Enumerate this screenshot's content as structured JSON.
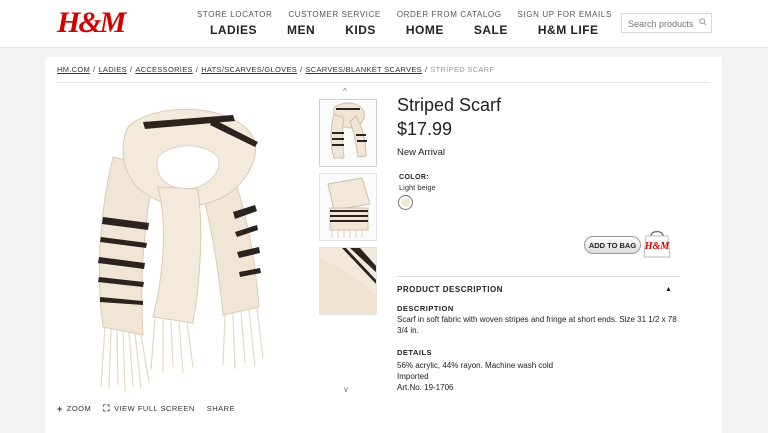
{
  "brand": {
    "logo": "H&M",
    "logo_color": "#d50000"
  },
  "header": {
    "utility_links": [
      "STORE LOCATOR",
      "CUSTOMER SERVICE",
      "ORDER FROM CATALOG",
      "SIGN UP FOR EMAILS"
    ],
    "nav": [
      "LADIES",
      "MEN",
      "KIDS",
      "HOME",
      "SALE",
      "H&M LIFE"
    ],
    "search_placeholder": "Search products"
  },
  "breadcrumb": {
    "items": [
      "HM.COM",
      "LADIES",
      "ACCESSORIES",
      "HATS/SCARVES/GLOVES",
      "SCARVES/BLANKET SCARVES"
    ],
    "current": "STRIPED SCARF",
    "separator": "/"
  },
  "gallery": {
    "main_image": "striped-scarf-photo",
    "thumbnails": [
      "scarf-draped-thumbnail",
      "scarf-folded-thumbnail",
      "scarf-detail-thumbnail"
    ],
    "tools": {
      "zoom": "ZOOM",
      "full_screen": "VIEW FULL SCREEN",
      "share": "SHARE"
    }
  },
  "product": {
    "title": "Striped Scarf",
    "price": "$17.99",
    "badge": "New Arrival",
    "color_label": "COLOR:",
    "color_name": "Light beige",
    "swatch_color": "#f0e6d4",
    "add_to_bag": "ADD TO BAG",
    "bag_logo": "H&M"
  },
  "description": {
    "section_title": "PRODUCT DESCRIPTION",
    "description_label": "DESCRIPTION",
    "description_text": "Scarf in soft fabric with woven stripes and fringe at short ends. Size 31 1/2 x 78 3/4 in.",
    "details_label": "DETAILS",
    "details": [
      "56% acrylic, 44% rayon. Machine wash cold",
      "Imported",
      "Art.No. 19-1706"
    ]
  }
}
